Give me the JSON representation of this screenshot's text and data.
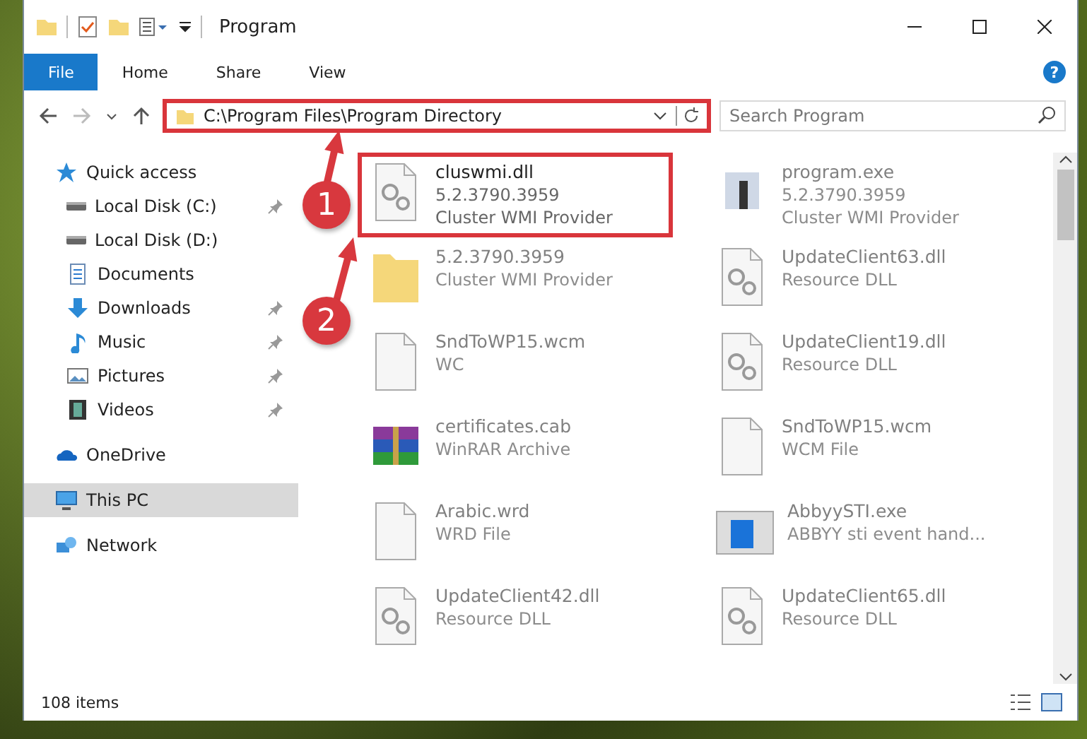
{
  "window": {
    "title": "Program"
  },
  "ribbon": {
    "tabs": [
      {
        "label": "File",
        "selected": true
      },
      {
        "label": "Home",
        "selected": false
      },
      {
        "label": "Share",
        "selected": false
      },
      {
        "label": "View",
        "selected": false
      }
    ],
    "help": "?"
  },
  "address_bar": {
    "path": "C:\\Program Files\\Program Directory",
    "highlighted": true
  },
  "search": {
    "placeholder": "Search Program"
  },
  "sidebar": {
    "items": [
      {
        "label": "Quick access",
        "kind": "section",
        "selected": false,
        "pinned": false
      },
      {
        "label": "Local Disk (C:)",
        "kind": "place",
        "selected": false,
        "pinned": true
      },
      {
        "label": "Local Disk (D:)",
        "kind": "place",
        "selected": false,
        "pinned": false
      },
      {
        "label": "Documents",
        "kind": "place",
        "selected": false,
        "pinned": false
      },
      {
        "label": "Downloads",
        "kind": "place",
        "selected": false,
        "pinned": true
      },
      {
        "label": "Music",
        "kind": "place",
        "selected": false,
        "pinned": true
      },
      {
        "label": "Pictures",
        "kind": "place",
        "selected": false,
        "pinned": true
      },
      {
        "label": "Videos",
        "kind": "place",
        "selected": false,
        "pinned": true
      },
      {
        "label": "OneDrive",
        "kind": "section",
        "selected": false,
        "pinned": false
      },
      {
        "label": "This PC",
        "kind": "section",
        "selected": true,
        "pinned": false
      },
      {
        "label": "Network",
        "kind": "section",
        "selected": false,
        "pinned": false
      }
    ]
  },
  "files": [
    {
      "kind": "gear",
      "lines": [
        "cluswmi.dll",
        "5.2.3790.3959",
        "Cluster WMI Provider"
      ],
      "highlighted": true,
      "dimmed": false
    },
    {
      "kind": "exe",
      "lines": [
        "program.exe",
        "5.2.3790.3959",
        "Cluster WMI Provider"
      ],
      "highlighted": false,
      "dimmed": true
    },
    {
      "kind": "folder",
      "lines": [
        "5.2.3790.3959",
        "Cluster WMI Provider"
      ],
      "highlighted": false,
      "dimmed": true
    },
    {
      "kind": "gear",
      "lines": [
        "UpdateClient63.dll",
        "Resource DLL"
      ],
      "highlighted": false,
      "dimmed": true
    },
    {
      "kind": "blank",
      "lines": [
        "SndToWP15.wcm",
        "WC"
      ],
      "highlighted": false,
      "dimmed": true
    },
    {
      "kind": "gear",
      "lines": [
        "UpdateClient19.dll",
        "Resource DLL"
      ],
      "highlighted": false,
      "dimmed": true
    },
    {
      "kind": "archive",
      "lines": [
        "certificates.cab",
        "WinRAR Archive"
      ],
      "highlighted": false,
      "dimmed": true
    },
    {
      "kind": "blank",
      "lines": [
        "SndToWP15.wcm",
        "WCM File"
      ],
      "highlighted": false,
      "dimmed": true
    },
    {
      "kind": "blank",
      "lines": [
        "Arabic.wrd",
        "WRD File"
      ],
      "highlighted": false,
      "dimmed": true
    },
    {
      "kind": "app",
      "lines": [
        "AbbyySTI.exe",
        "ABBYY sti event hand..."
      ],
      "highlighted": false,
      "dimmed": true
    },
    {
      "kind": "gear",
      "lines": [
        "UpdateClient42.dll",
        "Resource DLL"
      ],
      "highlighted": false,
      "dimmed": true
    },
    {
      "kind": "gear",
      "lines": [
        "UpdateClient65.dll",
        "Resource DLL"
      ],
      "highlighted": false,
      "dimmed": true
    }
  ],
  "status_bar": {
    "count": "108 items"
  },
  "annotations": [
    {
      "label": "1"
    },
    {
      "label": "2"
    }
  ]
}
